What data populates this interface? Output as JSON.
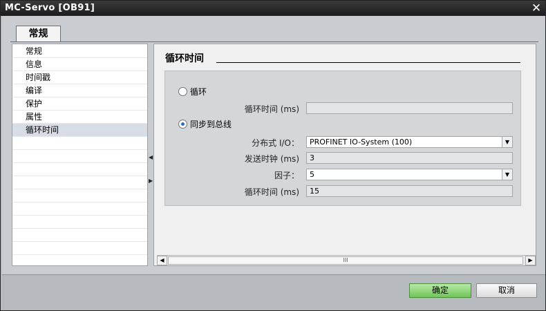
{
  "window": {
    "title": "MC-Servo [OB91]",
    "close_glyph": "✕"
  },
  "tab": {
    "label": "常规"
  },
  "nav": {
    "items": [
      {
        "label": "常规",
        "selected": false
      },
      {
        "label": "信息",
        "selected": false
      },
      {
        "label": "时间戳",
        "selected": false
      },
      {
        "label": "编译",
        "selected": false
      },
      {
        "label": "保护",
        "selected": false
      },
      {
        "label": "属性",
        "selected": false
      },
      {
        "label": "循环时间",
        "selected": true
      }
    ]
  },
  "splitter": {
    "collapse_glyph": "◀",
    "expand_glyph": "▶"
  },
  "content": {
    "section_title": "循环时间",
    "radio_cyclic": {
      "label": "循环",
      "checked": false
    },
    "cyclic_time": {
      "label": "循环时间 (ms)",
      "value": ""
    },
    "radio_sync": {
      "label": "同步到总线",
      "checked": true
    },
    "distributed_io": {
      "label": "分布式 I/O：",
      "value": "PROFINET IO-System (100)"
    },
    "send_clock": {
      "label": "发送时钟 (ms)",
      "value": "3"
    },
    "factor": {
      "label": "因子：",
      "value": "5"
    },
    "sync_cycle_time": {
      "label": "循环时间 (ms)",
      "value": "15"
    }
  },
  "scrollbar": {
    "left_glyph": "◀",
    "right_glyph": "▶",
    "thumb_glyph": "III"
  },
  "dropdown_glyph": "▼",
  "footer": {
    "ok_label": "确定",
    "cancel_label": "取消"
  },
  "colors": {
    "ok_button": "#7acb62",
    "radio_dot": "#2f6bd0",
    "title_bar": "#262626"
  }
}
